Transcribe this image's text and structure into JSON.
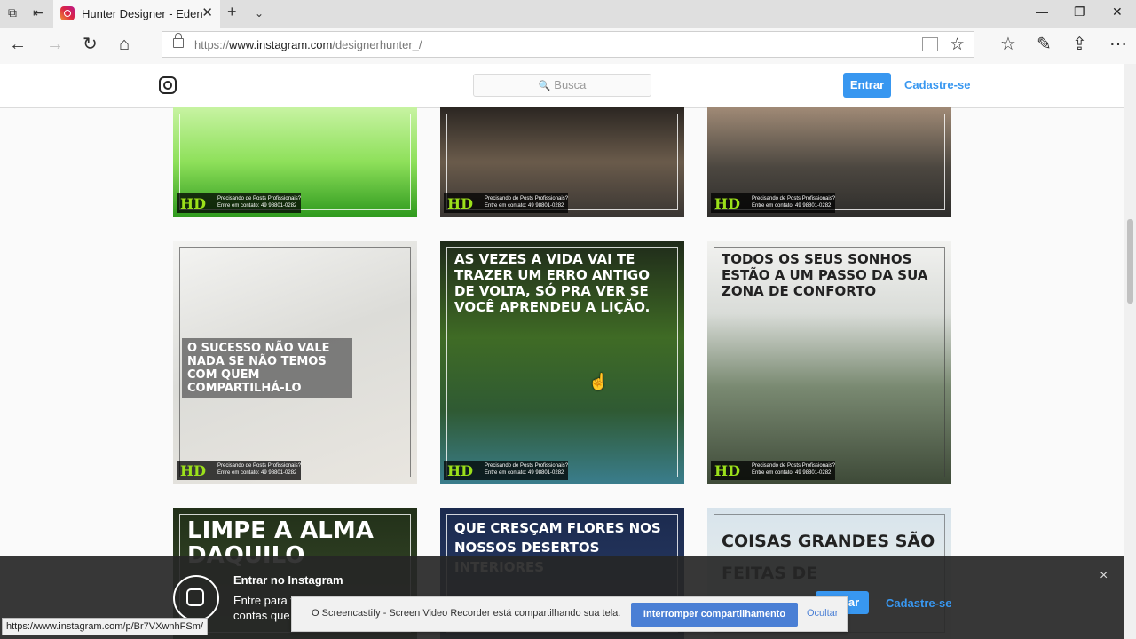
{
  "browser": {
    "tab_title": "Hunter Designer - Eden",
    "url_prefix": "https://",
    "url_host": "www.instagram.com",
    "url_path": "/designerhunter_/",
    "icons": [
      "tabs-icon",
      "back-tabs-icon",
      "new-tab-icon",
      "tab-list-icon",
      "back-icon",
      "forward-icon",
      "refresh-icon",
      "home-icon",
      "lock-icon",
      "reading-view-icon",
      "favorite-star-icon",
      "favorites-icon",
      "notes-icon",
      "share-icon",
      "more-icon",
      "minimize-icon",
      "maximize-icon",
      "close-window-icon"
    ]
  },
  "header": {
    "search_placeholder": "Busca",
    "login_label": "Entrar",
    "signup_label": "Cadastre-se"
  },
  "watermark": {
    "brand": "HD",
    "line1": "Precisando de Posts Profissionais?",
    "line2": "Entre em contato: 49 98801-0282"
  },
  "posts": [
    {
      "caption": ""
    },
    {
      "caption": ""
    },
    {
      "caption": ""
    },
    {
      "caption": "O sucesso não vale nada se não temos com quem compartilhá-lo"
    },
    {
      "caption": "As vezes a vida vai te trazer um erro antigo de volta, só pra ver se você aprendeu a lição."
    },
    {
      "caption": "Todos os seus sonhos estão a um passo da sua zona de conforto"
    },
    {
      "caption": "Limpe a alma daquilo"
    },
    {
      "caption": "Que cresçam flores nos nossos desertos interiores"
    },
    {
      "caption": "Coisas grandes são feitas de"
    }
  ],
  "login_bar": {
    "title": "Entrar no Instagram",
    "text": "Entre para ver fotos e vídeos de amigos e descubra outras contas que você vai adorar.",
    "login_label": "Entrar",
    "signup_label": "Cadastre-se",
    "close": "×"
  },
  "screencastify": {
    "message": "O Screencastify - Screen Video Recorder está compartilhando sua tela.",
    "stop_label": "Interromper compartilhamento",
    "hide_label": "Ocultar"
  },
  "status_url": "https://www.instagram.com/p/Br7VXwnhFSm/",
  "colors": {
    "accent": "#3897f0",
    "hd_green": "#9be01a"
  }
}
